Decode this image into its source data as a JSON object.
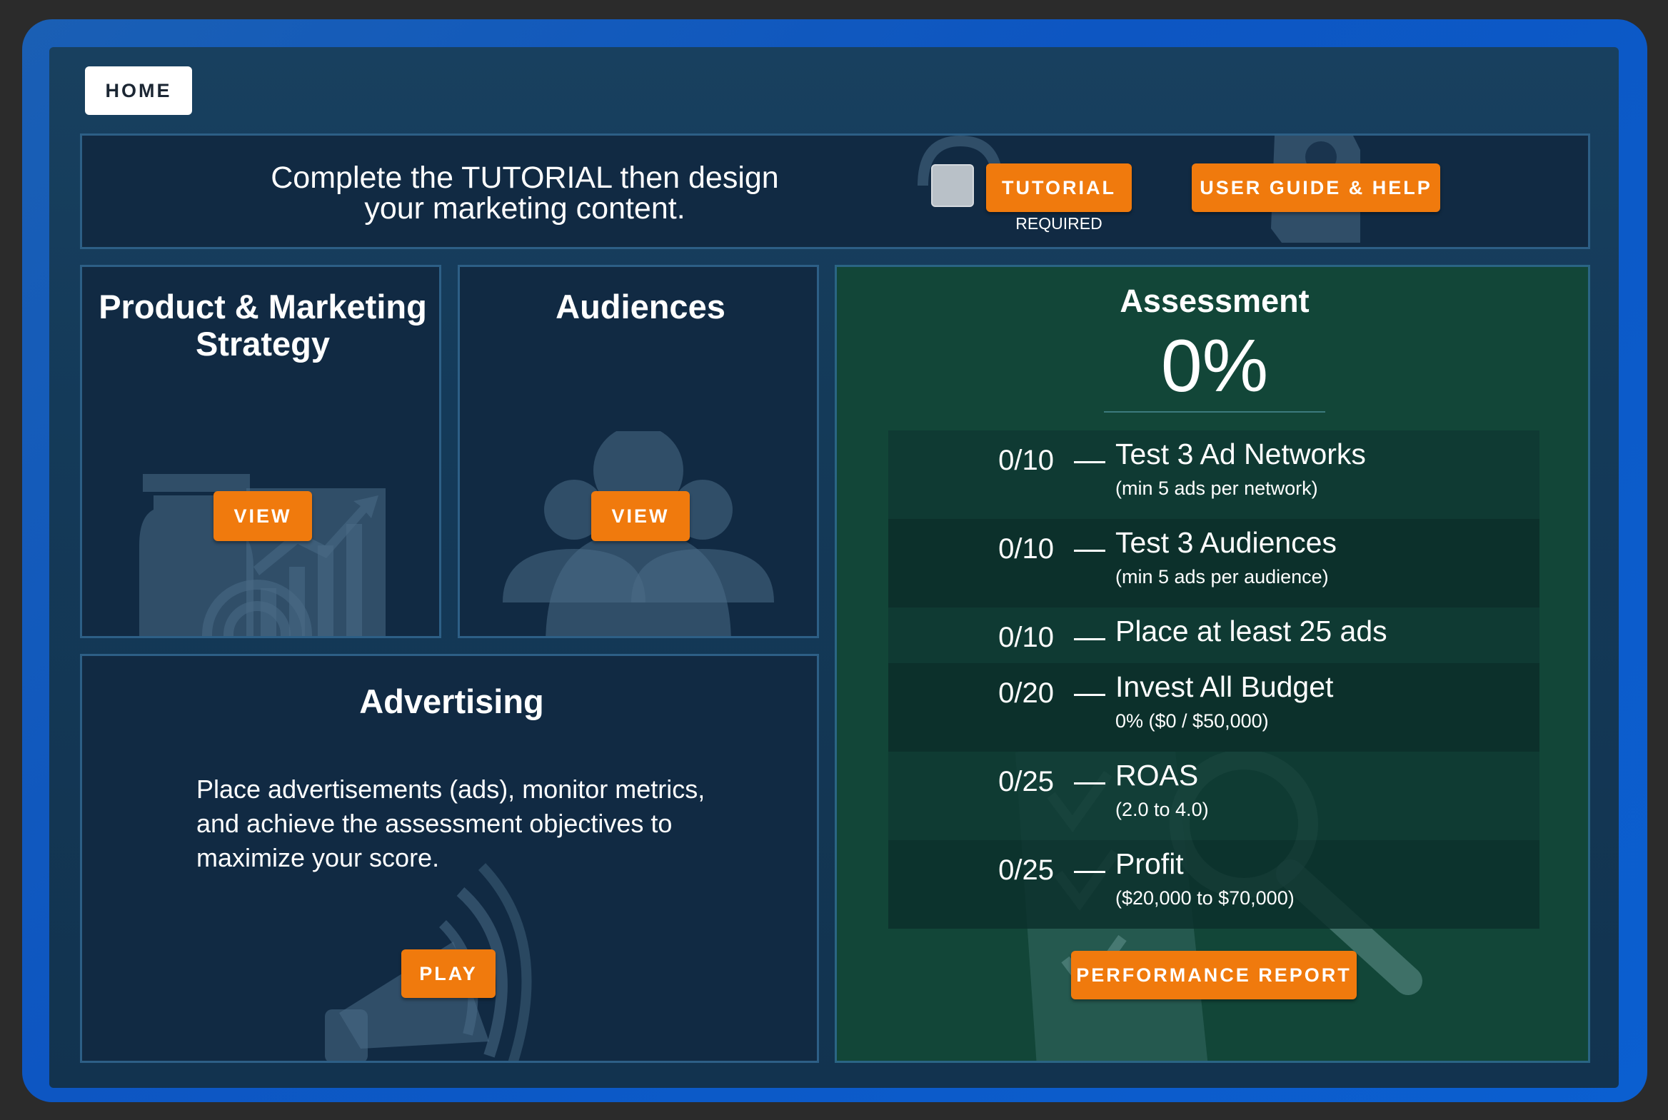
{
  "nav": {
    "home_label": "HOME"
  },
  "banner": {
    "message_line1": "Complete the TUTORIAL then design",
    "message_line2": "your marketing content.",
    "tutorial_label": "TUTORIAL",
    "required_label": "REQUIRED",
    "guide_label": "USER GUIDE & HELP"
  },
  "cards": {
    "product": {
      "title_line1": "Product & Marketing",
      "title_line2": "Strategy",
      "button_label": "VIEW"
    },
    "audiences": {
      "title": "Audiences",
      "button_label": "VIEW"
    },
    "advertising": {
      "title": "Advertising",
      "desc_line1": "Place advertisements (ads), monitor metrics,",
      "desc_line2": "and achieve the assessment objectives to",
      "desc_line3": "maximize your score.",
      "button_label": "PLAY"
    }
  },
  "assessment": {
    "title": "Assessment",
    "score": "0%",
    "objectives": [
      {
        "score": "0/10",
        "title": "Test 3 Ad Networks",
        "subtitle": "(min 5 ads per network)"
      },
      {
        "score": "0/10",
        "title": "Test 3 Audiences",
        "subtitle": "(min 5 ads per audience)"
      },
      {
        "score": "0/10",
        "title": "Place at least 25 ads",
        "subtitle": ""
      },
      {
        "score": "0/20",
        "title": "Invest All Budget",
        "subtitle": "0% ($0 / $50,000)"
      },
      {
        "score": "0/25",
        "title": "ROAS",
        "subtitle": "(2.0 to 4.0)"
      },
      {
        "score": "0/25",
        "title": "Profit",
        "subtitle": "($20,000 to $70,000)"
      }
    ],
    "report_label": "PERFORMANCE REPORT"
  },
  "colors": {
    "accent_orange": "#f07a0d",
    "panel_dark": "#112a43",
    "assessment_green": "#124638",
    "frame_blue": "#0d56c2"
  }
}
